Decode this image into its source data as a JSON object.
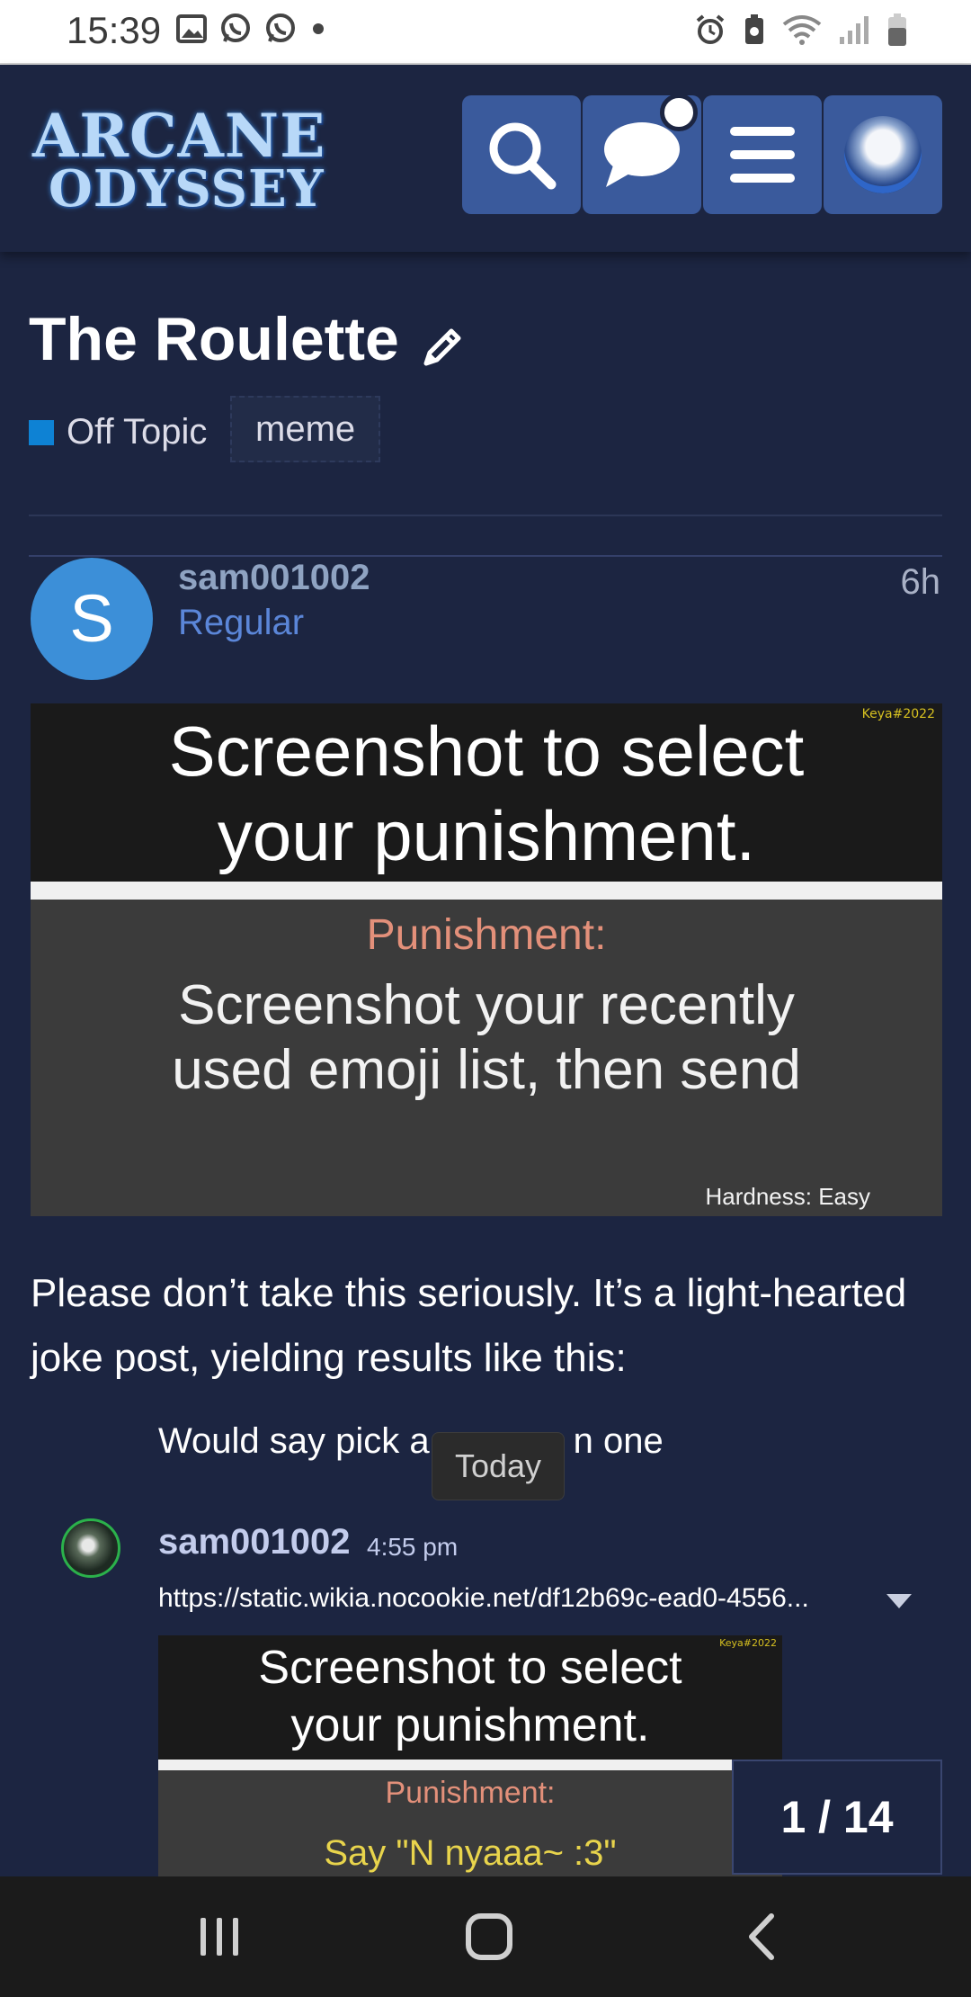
{
  "status_bar": {
    "time": "15:39",
    "left_icons": [
      "image-icon",
      "whatsapp-icon",
      "whatsapp-icon",
      "dot-icon"
    ],
    "right_icons": [
      "alarm-icon",
      "battery-saver-icon",
      "wifi-icon",
      "signal-icon",
      "battery-icon"
    ]
  },
  "header": {
    "logo_line1": "ARCANE",
    "logo_line2": "ODYSSEY",
    "buttons": [
      "search-icon",
      "chat-icon",
      "menu-icon",
      "avatar"
    ]
  },
  "topic": {
    "title": "The Roulette",
    "category": "Off Topic",
    "category_color": "#0e82d4",
    "tag": "meme"
  },
  "post": {
    "avatar_letter": "S",
    "username": "sam001002",
    "role": "Regular",
    "time": "6h",
    "image": {
      "watermark": "Keya#2022",
      "headline_line1": "Screenshot to select",
      "headline_line2": "your punishment.",
      "punishment_label": "Punishment:",
      "punishment_line1": "Screenshot your recently",
      "punishment_line2": "used emoji list, then send",
      "hardness": "Hardness: Easy"
    },
    "body_line1": "Please don’t take this seriously. It’s a light-hearted",
    "body_line2": "joke post, yielding results like this:"
  },
  "embed": {
    "quote_before": "Would say pick a",
    "quote_after": "n one",
    "today_label": "Today",
    "username": "sam001002",
    "time": "4:55 pm",
    "link": "https://static.wikia.nocookie.net/df12b69c-ead0-4556...",
    "image": {
      "watermark": "Keya#2022",
      "headline_line1": "Screenshot to select",
      "headline_line2": "your punishment.",
      "punishment_label": "Punishment:",
      "punishment_text": "Say \"N nyaaa~ :3\""
    }
  },
  "progress": {
    "label": "1 / 14",
    "current": 1,
    "total": 14
  },
  "nav_bar": [
    "recents-icon",
    "home-icon",
    "back-icon"
  ]
}
